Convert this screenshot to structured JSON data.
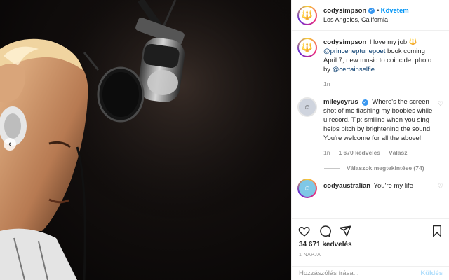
{
  "post": {
    "username": "codysimpson",
    "follow_separator": "•",
    "follow_label": "Követem",
    "location": "Los Angeles, California",
    "caption": {
      "username": "codysimpson",
      "text_1": "I love my job 🔱",
      "mention_1": "@princeneptunepoet",
      "text_2": " book coming April 7, new music to coincide. photo by ",
      "mention_2": "@certainselfie",
      "time": "1n"
    },
    "comments": [
      {
        "username": "mileycyrus",
        "text": "Where's the screen shot of me flashing my boobies while u record. Tip: smiling when you sing helps pitch by brightening the sound! You're welcome for all the above!",
        "time": "1n",
        "likes": "1 670 kedvelés",
        "reply_label": "Válasz",
        "replies_label": "Válaszok megtekintése (74)"
      },
      {
        "username": "codyaustralian",
        "text": "You're my life"
      }
    ],
    "likes": "34 671 kedvelés",
    "posted": "1 NAPJA",
    "comment_placeholder": "Hozzászólás írása...",
    "post_button": "Küldés"
  },
  "icons": {
    "verified": "verified-badge-icon",
    "heart": "heart-icon",
    "comment": "comment-icon",
    "share": "share-icon",
    "save": "bookmark-icon",
    "prev": "chevron-left-icon"
  },
  "colors": {
    "link_blue": "#0095f6",
    "mention_blue": "#00376b",
    "muted_gray": "#8e8e8e",
    "verified_blue": "#3897f0"
  }
}
